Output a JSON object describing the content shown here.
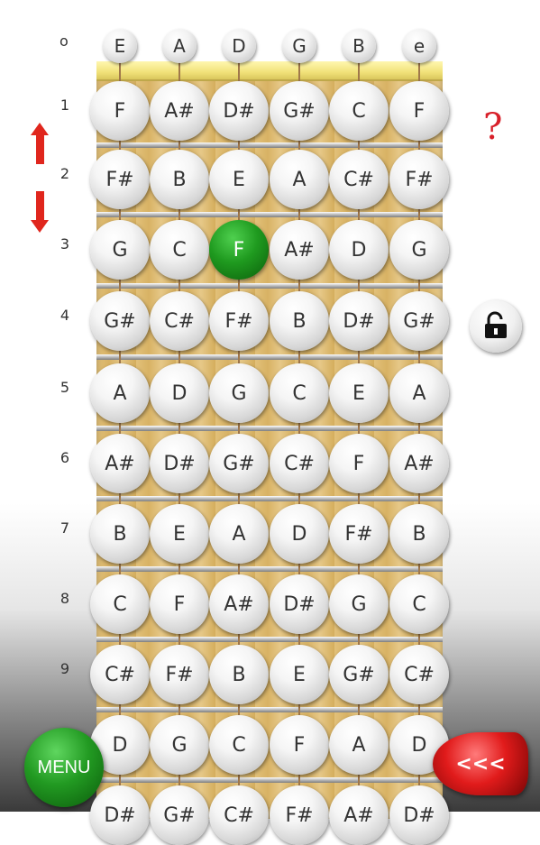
{
  "open_marker": "o",
  "open_strings": [
    "E",
    "A",
    "D",
    "G",
    "B",
    "e"
  ],
  "fret_numbers": [
    "1",
    "2",
    "3",
    "4",
    "5",
    "6",
    "7",
    "8",
    "9"
  ],
  "frets": [
    [
      "F",
      "A#",
      "D#",
      "G#",
      "C",
      "F"
    ],
    [
      "F#",
      "B",
      "E",
      "A",
      "C#",
      "F#"
    ],
    [
      "G",
      "C",
      "F",
      "A#",
      "D",
      "G"
    ],
    [
      "G#",
      "C#",
      "F#",
      "B",
      "D#",
      "G#"
    ],
    [
      "A",
      "D",
      "G",
      "C",
      "E",
      "A"
    ],
    [
      "A#",
      "D#",
      "G#",
      "C#",
      "F",
      "A#"
    ],
    [
      "B",
      "E",
      "A",
      "D",
      "F#",
      "B"
    ],
    [
      "C",
      "F",
      "A#",
      "D#",
      "G",
      "C"
    ],
    [
      "C#",
      "F#",
      "B",
      "E",
      "G#",
      "C#"
    ],
    [
      "D",
      "G",
      "C",
      "F",
      "A",
      "D"
    ],
    [
      "D#",
      "G#",
      "C#",
      "F#",
      "A#",
      "D#"
    ]
  ],
  "active_note": {
    "fret": 3,
    "string": 3
  },
  "help_label": "?",
  "menu_label": "MENU",
  "back_label": "<<<",
  "icons": {
    "scroll_up": "arrow-up-icon",
    "scroll_down": "arrow-down-icon",
    "lock": "unlock-icon"
  },
  "colors": {
    "active": "#1f9a1f",
    "arrows": "#e0261d",
    "menu": "#229a22",
    "back": "#e11b1b"
  }
}
